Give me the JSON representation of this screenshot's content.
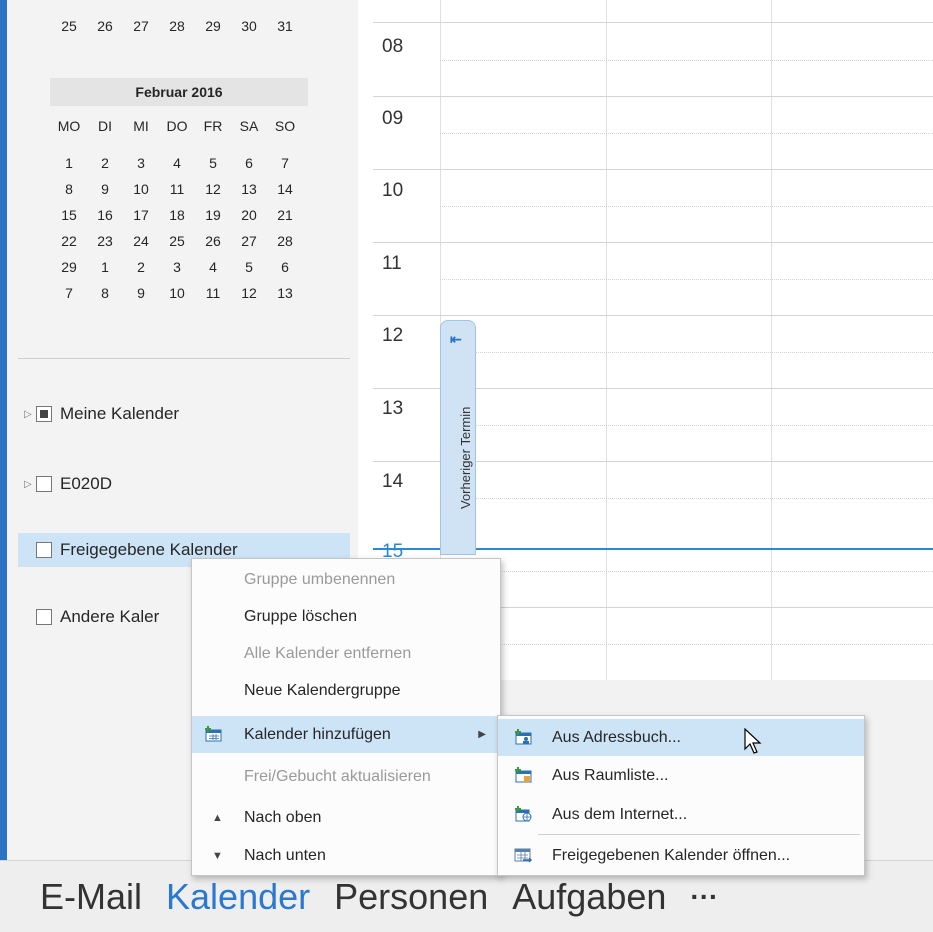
{
  "mini_calendar_top_row": [
    "25",
    "26",
    "27",
    "28",
    "29",
    "30",
    "31"
  ],
  "mini_calendar": {
    "month_title": "Februar 2016",
    "weekdays": [
      "MO",
      "DI",
      "MI",
      "DO",
      "FR",
      "SA",
      "SO"
    ],
    "weeks": [
      [
        "1",
        "2",
        "3",
        "4",
        "5",
        "6",
        "7"
      ],
      [
        "8",
        "9",
        "10",
        "11",
        "12",
        "13",
        "14"
      ],
      [
        "15",
        "16",
        "17",
        "18",
        "19",
        "20",
        "21"
      ],
      [
        "22",
        "23",
        "24",
        "25",
        "26",
        "27",
        "28"
      ],
      [
        "29",
        "1",
        "2",
        "3",
        "4",
        "5",
        "6"
      ],
      [
        "7",
        "8",
        "9",
        "10",
        "11",
        "12",
        "13"
      ]
    ]
  },
  "calendar_groups": {
    "meine": "Meine Kalender",
    "e020d": "E020D",
    "freigegebene": "Freigegebene Kalender",
    "andere": "Andere Kaler"
  },
  "hours": [
    "08",
    "09",
    "10",
    "11",
    "12",
    "13",
    "14",
    "15"
  ],
  "previous_appointment_label": "Vorheriger Termin",
  "context_menu": {
    "rename": "Gruppe umbenennen",
    "delete": "Gruppe löschen",
    "remove_all": "Alle Kalender entfernen",
    "new_group": "Neue Kalendergruppe",
    "add_calendar": "Kalender hinzufügen",
    "refresh_freebusy": "Frei/Gebucht aktualisieren",
    "move_up": "Nach oben",
    "move_down": "Nach unten"
  },
  "submenu": {
    "from_address_book": "Aus Adressbuch...",
    "from_room_list": "Aus Raumliste...",
    "from_internet": "Aus dem Internet...",
    "open_shared": "Freigegebenen Kalender öffnen..."
  },
  "bottom_nav": {
    "mail": "E-Mail",
    "calendar": "Kalender",
    "people": "Personen",
    "tasks": "Aufgaben",
    "more": "···"
  },
  "colors": {
    "accent": "#2b73c4",
    "highlight": "#cde4f7",
    "now_line": "#2b88d8"
  }
}
